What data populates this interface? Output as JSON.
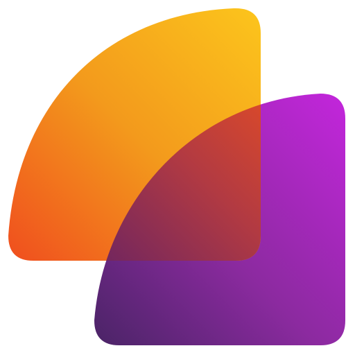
{
  "logo": {
    "colors": {
      "orange_light": "#FCC51C",
      "orange_mid": "#F39A1C",
      "orange_dark": "#F04E1E",
      "purple_light": "#C326DC",
      "purple_mid": "#8C2AA0",
      "purple_dark": "#4A2466",
      "overlap_top": "#E8491F",
      "overlap_bottom": "#5A1F6A"
    }
  }
}
